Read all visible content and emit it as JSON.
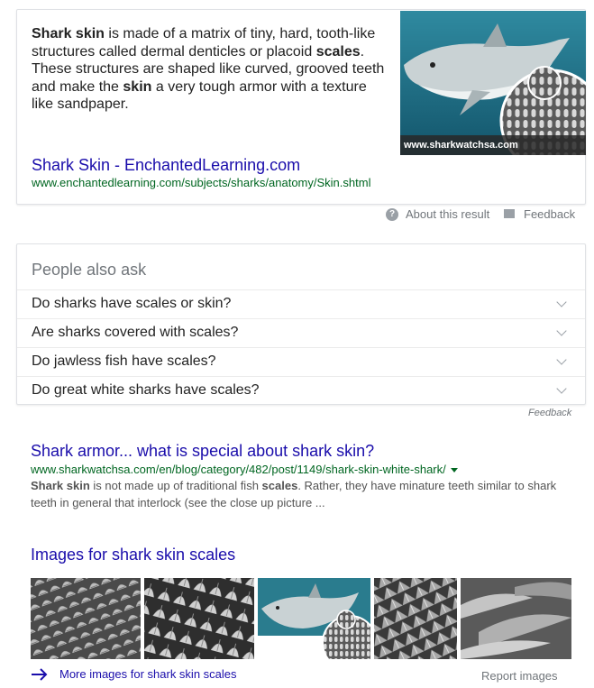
{
  "featured_snippet": {
    "text_parts": [
      {
        "text": "Shark skin",
        "bold": true
      },
      {
        "text": " is made of a matrix of tiny, hard, tooth-like structures called dermal denticles or placoid ",
        "bold": false
      },
      {
        "text": "scales",
        "bold": true
      },
      {
        "text": ". These structures are shaped like curved, grooved teeth and make the ",
        "bold": false
      },
      {
        "text": "skin",
        "bold": true
      },
      {
        "text": " a very tough armor with a texture like sandpaper.",
        "bold": false
      }
    ],
    "image_caption": "www.sharkwatchsa.com",
    "link_title": "Shark Skin - EnchantedLearning.com",
    "url": "www.enchantedlearning.com/subjects/sharks/anatomy/Skin.shtml",
    "about_label": "About this result",
    "feedback_label": "Feedback"
  },
  "people_also_ask": {
    "heading": "People also ask",
    "questions": [
      "Do sharks have scales or skin?",
      "Are sharks covered with scales?",
      "Do jawless fish have scales?",
      "Do great white sharks have scales?"
    ],
    "feedback_label": "Feedback"
  },
  "result": {
    "title": "Shark armor... what is special about shark skin?",
    "url": "www.sharkwatchsa.com/en/blog/category/482/post/1149/shark-skin-white-shark/",
    "snippet_parts": [
      {
        "text": "Shark skin",
        "bold": true
      },
      {
        "text": " is not made up of traditional fish ",
        "bold": false
      },
      {
        "text": "scales",
        "bold": true
      },
      {
        "text": ". Rather, they have minature teeth similar to shark teeth in general that interlock (see the close up picture ...",
        "bold": false
      }
    ]
  },
  "images": {
    "heading": "Images for shark skin scales",
    "more_label": "More images for shark skin scales",
    "report_label": "Report images"
  },
  "colors": {
    "link": "#1a0dab",
    "url": "#006621",
    "muted": "#70757a"
  }
}
